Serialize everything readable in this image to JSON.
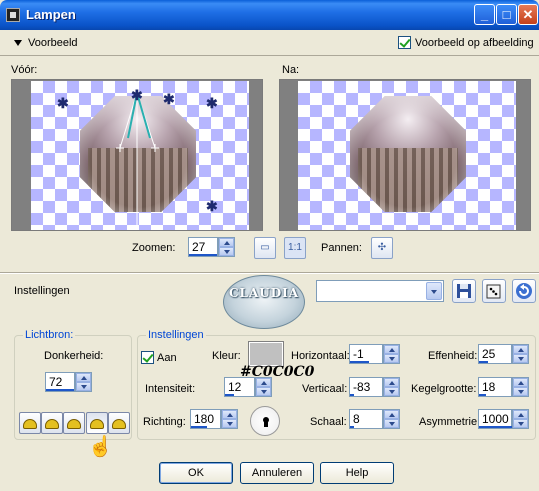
{
  "window": {
    "title": "Lampen",
    "controls": {
      "minimize": "_",
      "maximize": "□",
      "close": "✕"
    }
  },
  "preview_section": {
    "toggle_label": "Voorbeeld",
    "show_on_image_label": "Voorbeeld op afbeelding",
    "show_on_image_checked": true,
    "before_label": "Vóór:",
    "after_label": "Na:"
  },
  "zoom": {
    "label": "Zoomen:",
    "value": "27",
    "one_to_one": "1:1",
    "pan_label": "Pannen:"
  },
  "settings_bar": {
    "label": "Instellingen",
    "preset_value": ""
  },
  "watermark": {
    "text": "CLAUDIA"
  },
  "lichtbron": {
    "title": "Lichtbron:",
    "darkness_label": "Donkerheid:",
    "darkness_value": "72",
    "light_count": 5,
    "active_light": 4
  },
  "instellingen": {
    "title": "Instellingen",
    "on_label": "Aan",
    "on_checked": true,
    "color_label": "Kleur:",
    "color_value": "#C0C0C0",
    "color_hex": "#c0c0c0",
    "intensity_label": "Intensiteit:",
    "intensity_value": "12",
    "direction_label": "Richting:",
    "direction_value": "180",
    "horizontal_label": "Horizontaal:",
    "horizontal_value": "-1",
    "vertical_label": "Verticaal:",
    "vertical_value": "-83",
    "scale_label": "Schaal:",
    "scale_value": "8",
    "sharpness_label": "Effenheid:",
    "sharpness_value": "25",
    "cone_label": "Kegelgrootte:",
    "cone_value": "18",
    "asymmetry_label": "Asymmetrie:",
    "asymmetry_value": "1000"
  },
  "buttons": {
    "ok": "OK",
    "cancel": "Annuleren",
    "help": "Help"
  }
}
